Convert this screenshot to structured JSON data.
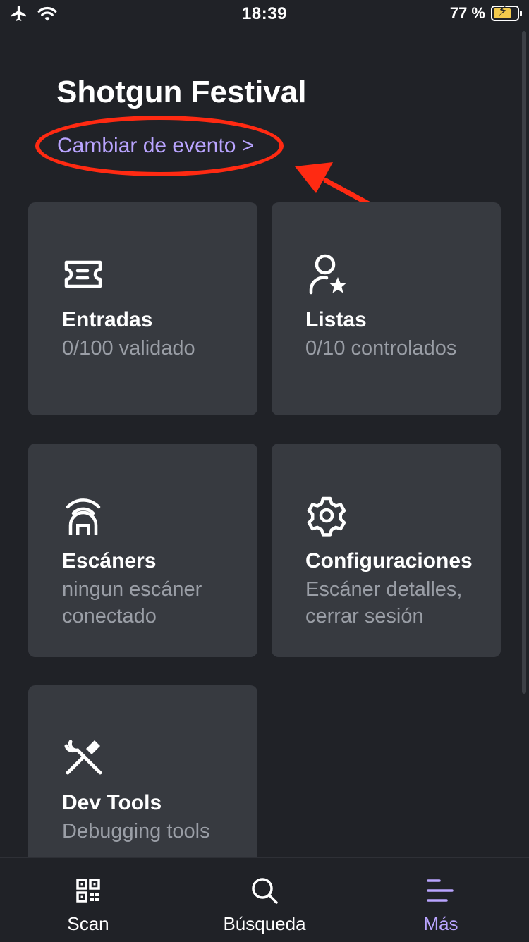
{
  "status_bar": {
    "time": "18:39",
    "battery": "77 %"
  },
  "event": {
    "title": "Shotgun Festival",
    "change_link": "Cambiar de evento >"
  },
  "tiles": [
    {
      "icon": "ticket-icon",
      "title": "Entradas",
      "subtitle": "0/100 validado"
    },
    {
      "icon": "user-star-icon",
      "title": "Listas",
      "subtitle": "0/10 controlados"
    },
    {
      "icon": "scanner-icon",
      "title": "Escáners",
      "subtitle": "ningun escáner conectado"
    },
    {
      "icon": "gear-icon",
      "title": "Configuraciones",
      "subtitle": "Escáner detalles, cerrar sesión"
    },
    {
      "icon": "tools-icon",
      "title": "Dev Tools",
      "subtitle": "Debugging tools"
    }
  ],
  "tabbar": {
    "tabs": [
      {
        "icon": "qr-code-icon",
        "label": "Scan"
      },
      {
        "icon": "search-icon",
        "label": "Búsqueda"
      },
      {
        "icon": "menu-icon",
        "label": "Más",
        "active": true
      }
    ]
  },
  "colors": {
    "background": "#202227",
    "tile": "#373a40",
    "accent": "#b9a4ff",
    "annotation": "#ff2a12"
  }
}
